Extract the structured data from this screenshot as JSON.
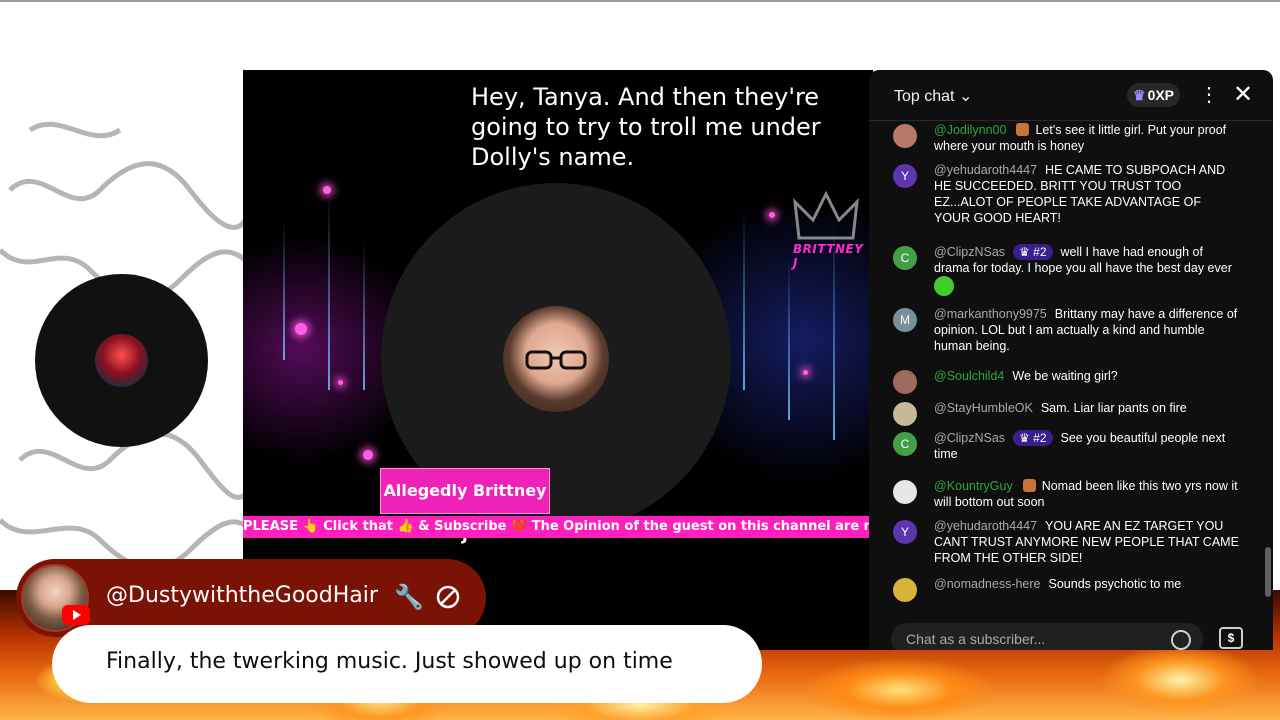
{
  "stream": {
    "caption": "Hey, Tanya. And then they're going to try to troll me under Dolly's name.",
    "host_name_tag": "Allegedly Brittney J",
    "logo_text": "BRITTNEY J",
    "ticker_text": "PLEASE 👆 Click that 👍 & Subscribe ❤️ The Opinion of the guest on this channel are not the same"
  },
  "chat": {
    "mode_label": "Top chat",
    "xp_label": "0XP",
    "input_placeholder": "Chat as a subscriber...",
    "colors": {
      "badge": "#3a1d8f",
      "green_author": "#2ba640"
    },
    "messages": [
      {
        "author": "@Jodilynn00",
        "text": "Let's see it little girl. Put your proof where your mouth is honey",
        "avatar_letter": "",
        "avatar_color": "#b57a6a",
        "green": true,
        "badge": ""
      },
      {
        "author": "@yehudaroth4447",
        "text": "HE CAME TO SUBPOACH AND HE SUCCEEDED. BRITT YOU TRUST TOO EZ...ALOT OF PEOPLE TAKE ADVANTAGE OF YOUR GOOD HEART!",
        "avatar_letter": "Y",
        "avatar_color": "#5e35b1",
        "green": false,
        "badge": ""
      },
      {
        "author": "@ClipzNSas",
        "text": "well I have had enough of drama for today. I hope you all have the best day ever",
        "avatar_letter": "C",
        "avatar_color": "#43a047",
        "green": false,
        "badge": "#2"
      },
      {
        "author": "@markanthony9975",
        "text": "Brittany may have a difference of opinion. LOL but I am actually a kind and humble human being.",
        "avatar_letter": "M",
        "avatar_color": "#78909c",
        "green": false,
        "badge": ""
      },
      {
        "author": "@Soulchild4",
        "text": "We be waiting girl?",
        "avatar_letter": "",
        "avatar_color": "#9c6b5e",
        "green": true,
        "badge": ""
      },
      {
        "author": "@StayHumbleOK",
        "text": "Sam. Liar liar pants on fire",
        "avatar_letter": "",
        "avatar_color": "#c9b89a",
        "green": false,
        "badge": ""
      },
      {
        "author": "@ClipzNSas",
        "text": "See you beautiful people next time",
        "avatar_letter": "C",
        "avatar_color": "#43a047",
        "green": false,
        "badge": "#2"
      },
      {
        "author": "@KountryGuy",
        "text": "Nomad been like this two yrs now it will bottom out soon",
        "avatar_letter": "",
        "avatar_color": "#e6e6e6",
        "green": true,
        "badge": ""
      },
      {
        "author": "@yehudaroth4447",
        "text": "YOU ARE AN EZ TARGET YOU CANT TRUST ANYMORE NEW PEOPLE THAT CAME FROM THE OTHER SIDE!",
        "avatar_letter": "Y",
        "avatar_color": "#5e35b1",
        "green": false,
        "badge": ""
      },
      {
        "author": "@nomadness-here",
        "text": "Sounds psychotic to me",
        "avatar_letter": "",
        "avatar_color": "#d8b33a",
        "green": false,
        "badge": ""
      }
    ]
  },
  "overlay": {
    "commenter": "@DustywiththeGoodHair",
    "comment": "Finally, the twerking music. Just showed up on time"
  }
}
